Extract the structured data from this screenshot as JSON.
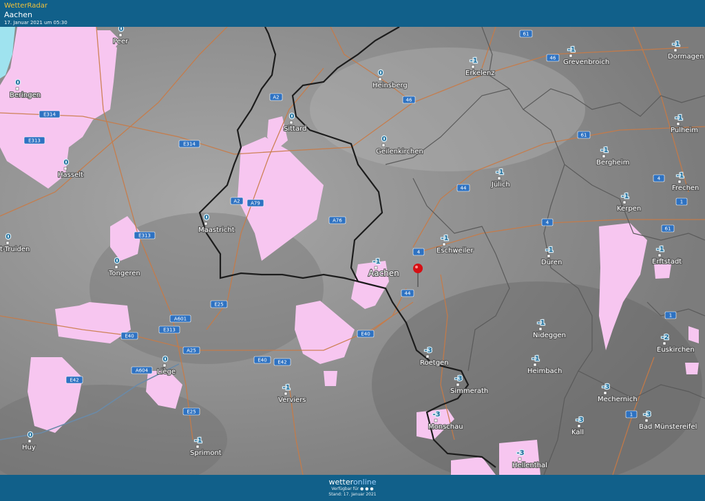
{
  "header": {
    "brand": "WetterRadar",
    "city": "Aachen",
    "time": "17. Januar 2021 um 05:30"
  },
  "footer": {
    "logo_a": "wetter",
    "logo_b": "online",
    "available": "Verfügbar für ● ● ●",
    "status": "Stand: 17. Januar 2021"
  },
  "places": [
    {
      "name": "Peer",
      "temp": "0"
    },
    {
      "name": "Beringen",
      "temp": "0"
    },
    {
      "name": "Hasselt",
      "temp": "0"
    },
    {
      "name": "t-Truiden",
      "temp": "0"
    },
    {
      "name": "Tongeren",
      "temp": "0"
    },
    {
      "name": "Liège",
      "temp": "0"
    },
    {
      "name": "Huy",
      "temp": "0"
    },
    {
      "name": "Sprimont",
      "temp": "-1"
    },
    {
      "name": "Verviers",
      "temp": "-1"
    },
    {
      "name": "Maastricht",
      "temp": "0"
    },
    {
      "name": "Sittard",
      "temp": "0"
    },
    {
      "name": "Heinsberg",
      "temp": "0"
    },
    {
      "name": "Geilenkirchen",
      "temp": "0"
    },
    {
      "name": "Erkelenz",
      "temp": "-1"
    },
    {
      "name": "Grevenbroich",
      "temp": "-1"
    },
    {
      "name": "Dormagen",
      "temp": "-1"
    },
    {
      "name": "Pulheim",
      "temp": "-1"
    },
    {
      "name": "Bergheim",
      "temp": "-1"
    },
    {
      "name": "Frechen",
      "temp": "-1"
    },
    {
      "name": "Kerpen",
      "temp": "-1"
    },
    {
      "name": "Jülich",
      "temp": "-1"
    },
    {
      "name": "Eschweiler",
      "temp": "-1"
    },
    {
      "name": "Aachen",
      "temp": "-1"
    },
    {
      "name": "Düren",
      "temp": "-1"
    },
    {
      "name": "Erftstadt",
      "temp": "-1"
    },
    {
      "name": "Nideggen",
      "temp": "-1"
    },
    {
      "name": "Euskirchen",
      "temp": "-2"
    },
    {
      "name": "Roetgen",
      "temp": "-3"
    },
    {
      "name": "Heimbach",
      "temp": "-1"
    },
    {
      "name": "Simmerath",
      "temp": "-3"
    },
    {
      "name": "Mechernich",
      "temp": "-3"
    },
    {
      "name": "Monschau",
      "temp": "-3"
    },
    {
      "name": "Kall",
      "temp": "-3"
    },
    {
      "name": "Bad Münstereifel",
      "temp": "-3"
    },
    {
      "name": "Hellenthal",
      "temp": "-3"
    }
  ],
  "roads": [
    "E314",
    "E313",
    "E314",
    "A2",
    "A2",
    "A79",
    "A76",
    "E313",
    "E25",
    "A601",
    "E313",
    "E40",
    "A25",
    "A604",
    "E42",
    "E25",
    "E40",
    "E42",
    "E40",
    "61",
    "46",
    "46",
    "61",
    "44",
    "4",
    "4",
    "4",
    "1",
    "61",
    "1",
    "1",
    "44"
  ]
}
